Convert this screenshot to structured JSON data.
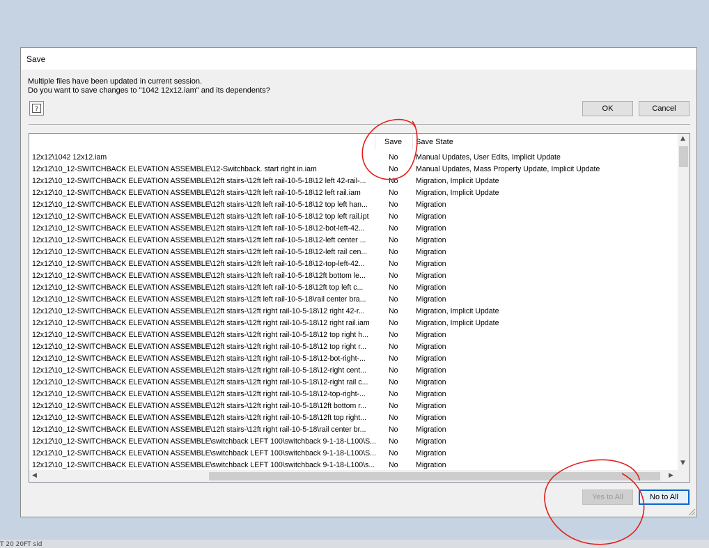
{
  "backdrop": {
    "text": "T 20 20FT sid"
  },
  "dialog": {
    "title": "Save",
    "message_line1": "Multiple files have been updated in current session.",
    "message_line2": "Do you want to save changes to \"1042 12x12.iam\" and its dependents?",
    "help_icon": "help-question-icon",
    "ok_label": "OK",
    "cancel_label": "Cancel",
    "yes_to_all_label": "Yes to All",
    "no_to_all_label": "No to All"
  },
  "table": {
    "columns": {
      "path": "",
      "save": "Save",
      "state": "Save State"
    },
    "rows": [
      {
        "path": "12x12\\1042 12x12.iam",
        "save": "No",
        "state": "Manual Updates, User Edits, Implicit Update"
      },
      {
        "path": "12x12\\10_12-SWITCHBACK ELEVATION ASSEMBLE\\12-Switchback. start right in.iam",
        "save": "No",
        "state": "Manual Updates, Mass Property Update, Implicit Update"
      },
      {
        "path": "12x12\\10_12-SWITCHBACK ELEVATION ASSEMBLE\\12ft stairs-\\12ft left rail-10-5-18\\12 left 42-rail-...",
        "save": "No",
        "state": "Migration, Implicit Update"
      },
      {
        "path": "12x12\\10_12-SWITCHBACK ELEVATION ASSEMBLE\\12ft stairs-\\12ft left rail-10-5-18\\12 left rail.iam",
        "save": "No",
        "state": "Migration, Implicit Update"
      },
      {
        "path": "12x12\\10_12-SWITCHBACK ELEVATION ASSEMBLE\\12ft stairs-\\12ft left rail-10-5-18\\12 top left han...",
        "save": "No",
        "state": "Migration"
      },
      {
        "path": "12x12\\10_12-SWITCHBACK ELEVATION ASSEMBLE\\12ft stairs-\\12ft left rail-10-5-18\\12 top left rail.ipt",
        "save": "No",
        "state": "Migration"
      },
      {
        "path": "12x12\\10_12-SWITCHBACK ELEVATION ASSEMBLE\\12ft stairs-\\12ft left rail-10-5-18\\12-bot-left-42...",
        "save": "No",
        "state": "Migration"
      },
      {
        "path": "12x12\\10_12-SWITCHBACK ELEVATION ASSEMBLE\\12ft stairs-\\12ft left rail-10-5-18\\12-left center ...",
        "save": "No",
        "state": "Migration"
      },
      {
        "path": "12x12\\10_12-SWITCHBACK ELEVATION ASSEMBLE\\12ft stairs-\\12ft left rail-10-5-18\\12-left rail cen...",
        "save": "No",
        "state": "Migration"
      },
      {
        "path": "12x12\\10_12-SWITCHBACK ELEVATION ASSEMBLE\\12ft stairs-\\12ft left rail-10-5-18\\12-top-left-42...",
        "save": "No",
        "state": "Migration"
      },
      {
        "path": "12x12\\10_12-SWITCHBACK ELEVATION ASSEMBLE\\12ft stairs-\\12ft left rail-10-5-18\\12ft bottom le...",
        "save": "No",
        "state": "Migration"
      },
      {
        "path": "12x12\\10_12-SWITCHBACK ELEVATION ASSEMBLE\\12ft stairs-\\12ft left rail-10-5-18\\12ft top left c...",
        "save": "No",
        "state": "Migration"
      },
      {
        "path": "12x12\\10_12-SWITCHBACK ELEVATION ASSEMBLE\\12ft stairs-\\12ft left rail-10-5-18\\rail center bra...",
        "save": "No",
        "state": "Migration"
      },
      {
        "path": "12x12\\10_12-SWITCHBACK ELEVATION ASSEMBLE\\12ft stairs-\\12ft right rail-10-5-18\\12 right 42-r...",
        "save": "No",
        "state": "Migration, Implicit Update"
      },
      {
        "path": "12x12\\10_12-SWITCHBACK ELEVATION ASSEMBLE\\12ft stairs-\\12ft right rail-10-5-18\\12 right rail.iam",
        "save": "No",
        "state": "Migration, Implicit Update"
      },
      {
        "path": "12x12\\10_12-SWITCHBACK ELEVATION ASSEMBLE\\12ft stairs-\\12ft right rail-10-5-18\\12 top right h...",
        "save": "No",
        "state": "Migration"
      },
      {
        "path": "12x12\\10_12-SWITCHBACK ELEVATION ASSEMBLE\\12ft stairs-\\12ft right rail-10-5-18\\12 top right r...",
        "save": "No",
        "state": "Migration"
      },
      {
        "path": "12x12\\10_12-SWITCHBACK ELEVATION ASSEMBLE\\12ft stairs-\\12ft right rail-10-5-18\\12-bot-right-...",
        "save": "No",
        "state": "Migration"
      },
      {
        "path": "12x12\\10_12-SWITCHBACK ELEVATION ASSEMBLE\\12ft stairs-\\12ft right rail-10-5-18\\12-right cent...",
        "save": "No",
        "state": "Migration"
      },
      {
        "path": "12x12\\10_12-SWITCHBACK ELEVATION ASSEMBLE\\12ft stairs-\\12ft right rail-10-5-18\\12-right rail c...",
        "save": "No",
        "state": "Migration"
      },
      {
        "path": "12x12\\10_12-SWITCHBACK ELEVATION ASSEMBLE\\12ft stairs-\\12ft right rail-10-5-18\\12-top-right-...",
        "save": "No",
        "state": "Migration"
      },
      {
        "path": "12x12\\10_12-SWITCHBACK ELEVATION ASSEMBLE\\12ft stairs-\\12ft right rail-10-5-18\\12ft bottom r...",
        "save": "No",
        "state": "Migration"
      },
      {
        "path": "12x12\\10_12-SWITCHBACK ELEVATION ASSEMBLE\\12ft stairs-\\12ft right rail-10-5-18\\12ft top right...",
        "save": "No",
        "state": "Migration"
      },
      {
        "path": "12x12\\10_12-SWITCHBACK ELEVATION ASSEMBLE\\12ft stairs-\\12ft right rail-10-5-18\\rail center br...",
        "save": "No",
        "state": "Migration"
      },
      {
        "path": "12x12\\10_12-SWITCHBACK ELEVATION ASSEMBLE\\switchback LEFT 100\\switchback 9-1-18-L100\\S...",
        "save": "No",
        "state": "Migration"
      },
      {
        "path": "12x12\\10_12-SWITCHBACK ELEVATION ASSEMBLE\\switchback LEFT 100\\switchback 9-1-18-L100\\S...",
        "save": "No",
        "state": "Migration"
      },
      {
        "path": "12x12\\10_12-SWITCHBACK ELEVATION ASSEMBLE\\switchback LEFT 100\\switchback 9-1-18-L100\\s...",
        "save": "No",
        "state": "Migration"
      }
    ]
  },
  "colors": {
    "annotation": "#e0201e",
    "default_button_border": "#0a64c8"
  }
}
